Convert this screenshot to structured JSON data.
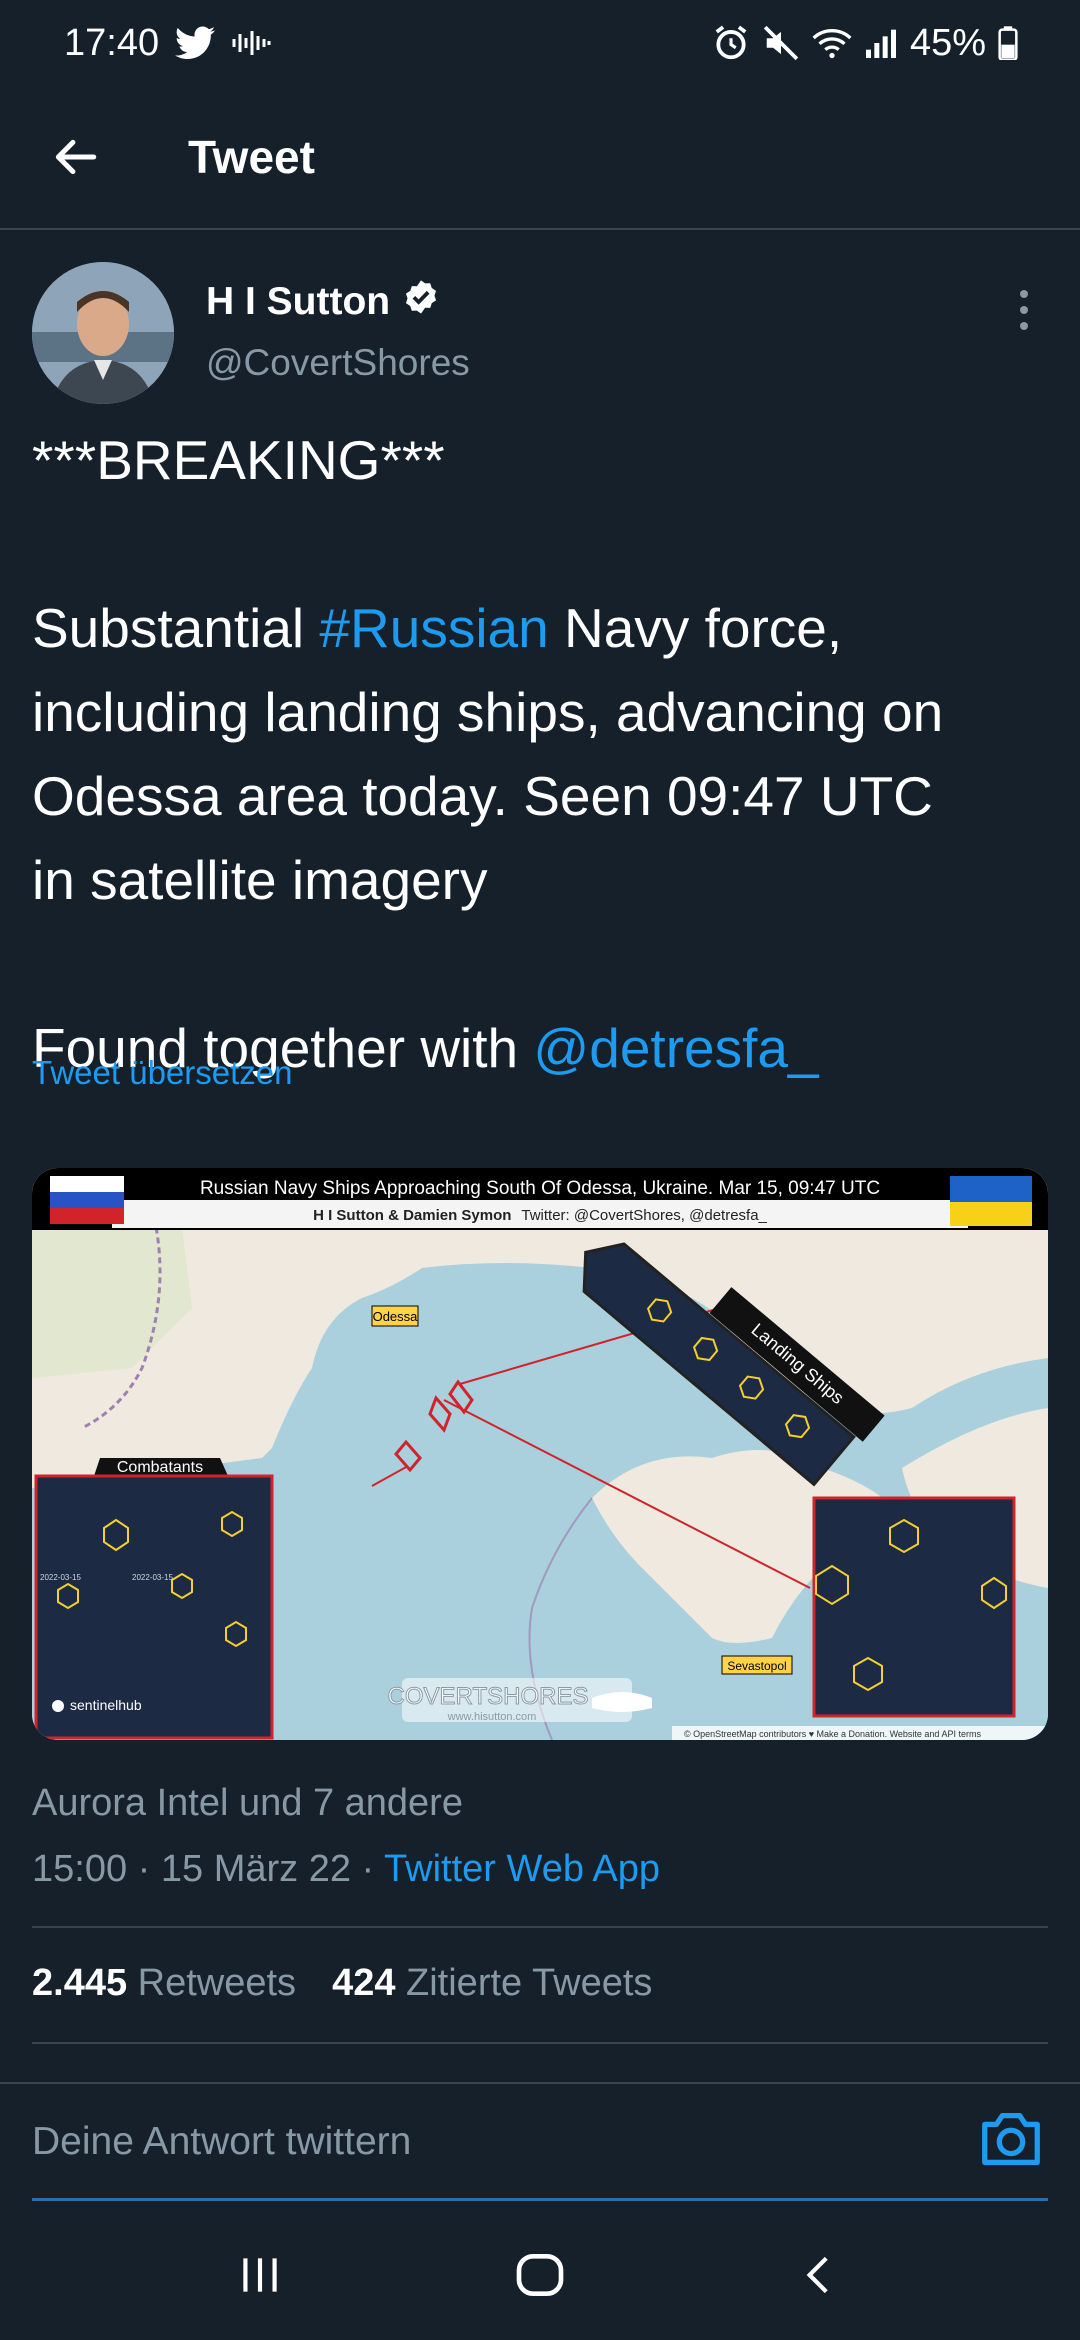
{
  "status_bar": {
    "time": "17:40",
    "battery": "45%"
  },
  "header": {
    "title": "Tweet"
  },
  "author": {
    "name": "H I Sutton",
    "handle": "@CovertShores"
  },
  "tweet": {
    "line1": "***BREAKING***",
    "line2_pre": "Substantial ",
    "line2_hashtag": "#Russian",
    "line2_post": " Navy force,",
    "line3": "including landing ships, advancing on",
    "line4": "Odessa area today. Seen 09:47 UTC",
    "line5": "in satellite imagery",
    "line6_pre": "Found together with ",
    "line6_mention": "@detresfa_",
    "translate": "Tweet übersetzen"
  },
  "media": {
    "title": "Russian Navy Ships Approaching South Of Odessa, Ukraine. Mar 15, 09:47 UTC",
    "credit_authors": "H I Sutton & Damien Symon",
    "credit_twitter": "Twitter: @CovertShores, @detresfa_",
    "label_odessa": "Odessa",
    "label_landing": "Landing Ships",
    "label_combatants": "Combatants",
    "label_sevastopol": "Sevastopol",
    "label_sentinel": "sentinelhub",
    "label_covertshores": "COVERTSHORES",
    "label_hisutton": "www.hisutton.com",
    "label_attribution": "© OpenStreetMap contributors ♥ Make a Donation. Website and API terms",
    "label_date1": "2022-03-15",
    "label_date2": "2022-03-15"
  },
  "meta": {
    "likers": "Aurora Intel und 7 andere",
    "time_date": "15:00 · 15 März 22 · ",
    "source": "Twitter Web App"
  },
  "stats": {
    "retweets_count": "2.445",
    "retweets_label": "Retweets",
    "quotes_count": "424",
    "quotes_label": "Zitierte Tweets"
  },
  "reply": {
    "placeholder": "Deine Antwort twittern"
  },
  "colors": {
    "background": "#15202b",
    "link": "#1d9bf0",
    "secondary": "#8899a6",
    "divider": "#38444d"
  }
}
